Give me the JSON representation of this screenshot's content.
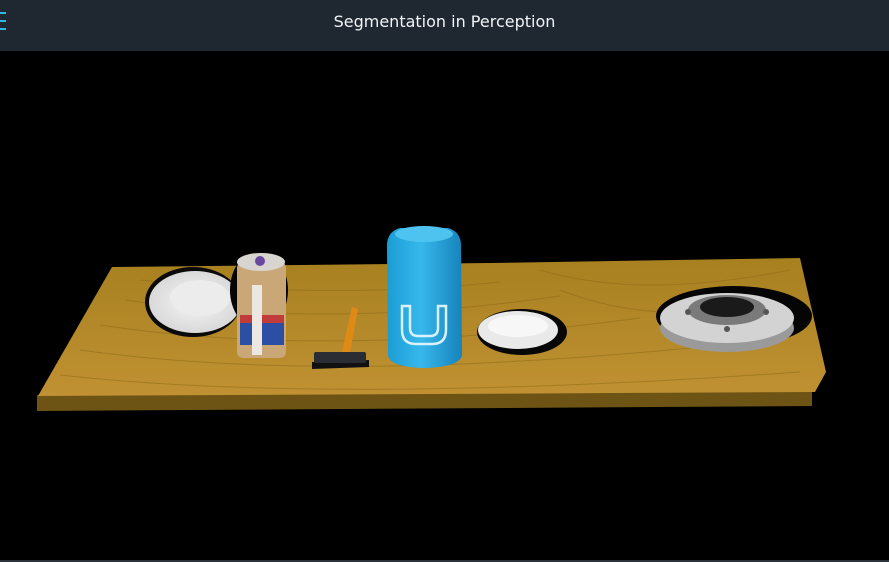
{
  "header": {
    "title": "Segmentation in Perception",
    "menu_icon": "hamburger-menu-icon",
    "background": "#1f2731",
    "accent": "#31b8e8"
  },
  "scene": {
    "background": "#000000",
    "table_color": "#b58a2a",
    "objects": [
      "bowl",
      "jar",
      "hammer",
      "soda-can",
      "small-bowl",
      "flange"
    ]
  }
}
